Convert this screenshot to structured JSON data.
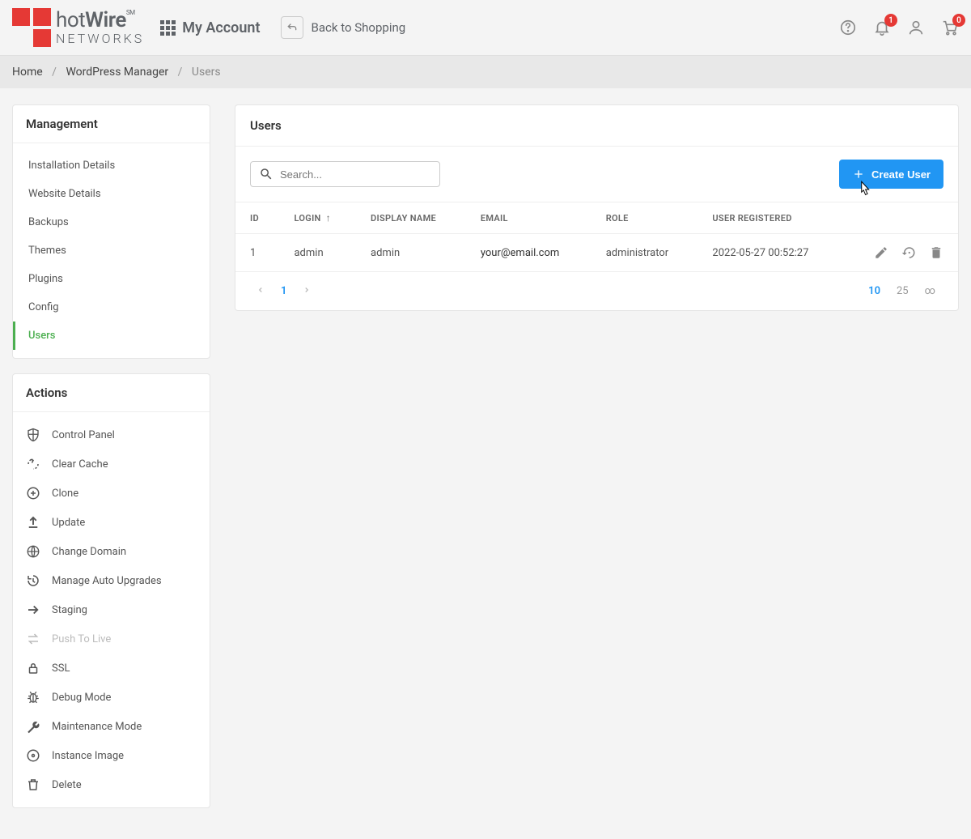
{
  "header": {
    "brand_main_a": "hot",
    "brand_main_b": "Wire",
    "brand_sm": "SM",
    "brand_sub": "NETWORKS",
    "my_account": "My Account",
    "back_to_shopping": "Back to Shopping",
    "notif_badge": "1",
    "cart_badge": "0"
  },
  "breadcrumb": {
    "home": "Home",
    "wp": "WordPress Manager",
    "current": "Users"
  },
  "sidebar": {
    "management_title": "Management",
    "mgmt": [
      {
        "label": "Installation Details"
      },
      {
        "label": "Website Details"
      },
      {
        "label": "Backups"
      },
      {
        "label": "Themes"
      },
      {
        "label": "Plugins"
      },
      {
        "label": "Config"
      },
      {
        "label": "Users",
        "active": true
      }
    ],
    "actions_title": "Actions",
    "actions": [
      {
        "label": "Control Panel",
        "icon": "shield"
      },
      {
        "label": "Clear Cache",
        "icon": "refresh-dashed"
      },
      {
        "label": "Clone",
        "icon": "plus-circle"
      },
      {
        "label": "Update",
        "icon": "upload"
      },
      {
        "label": "Change Domain",
        "icon": "globe"
      },
      {
        "label": "Manage Auto Upgrades",
        "icon": "history"
      },
      {
        "label": "Staging",
        "icon": "arrow-right"
      },
      {
        "label": "Push To Live",
        "icon": "swap",
        "disabled": true
      },
      {
        "label": "SSL",
        "icon": "lock"
      },
      {
        "label": "Debug Mode",
        "icon": "bug"
      },
      {
        "label": "Maintenance Mode",
        "icon": "wrench"
      },
      {
        "label": "Instance Image",
        "icon": "disc"
      },
      {
        "label": "Delete",
        "icon": "trash"
      }
    ]
  },
  "main": {
    "title": "Users",
    "search_placeholder": "Search...",
    "create_user": "Create User",
    "columns": {
      "id": "ID",
      "login": "LOGIN",
      "display_name": "DISPLAY NAME",
      "email": "EMAIL",
      "role": "ROLE",
      "user_registered": "USER REGISTERED"
    },
    "rows": [
      {
        "id": "1",
        "login": "admin",
        "display_name": "admin",
        "email": "your@email.com",
        "role": "administrator",
        "registered": "2022-05-27 00:52:27"
      }
    ],
    "pagination": {
      "current": "1",
      "sizes": [
        "10",
        "25",
        "∞"
      ],
      "active_size": "10"
    }
  }
}
